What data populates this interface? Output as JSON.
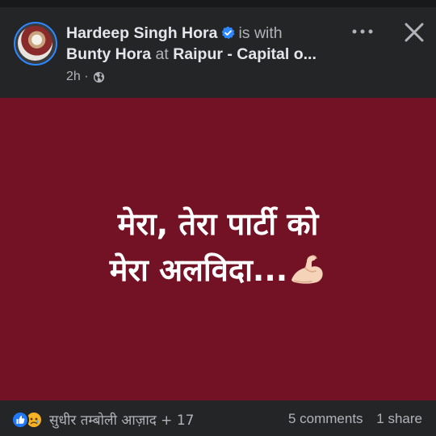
{
  "post": {
    "author": "Hardeep Singh Hora",
    "with_text": "is with",
    "tagged_user": "Bunty Hora",
    "at_text": "at",
    "location": "Raipur - Capital o...",
    "time": "2h ·",
    "privacy_icon": "globe-icon",
    "verified_icon": "verified-badge-icon",
    "body_lines": [
      "मेरा, तेरा पार्टी को",
      "मेरा अलविदा..."
    ],
    "body_emoji": "flexed-biceps-icon",
    "background_color": "#731225"
  },
  "header": {
    "more_icon": "more-options-icon",
    "close_icon": "close-icon"
  },
  "footer": {
    "reaction_icons": [
      "like-icon",
      "sad-icon"
    ],
    "reactors_text": "सुधीर तम्बोली आज़ाद + 17",
    "comments": "5 comments",
    "shares": "1 share"
  },
  "colors": {
    "surface": "#242526",
    "accent": "#2d88ff",
    "text_primary": "#e4e6eb",
    "text_secondary": "#b0b3b8"
  }
}
